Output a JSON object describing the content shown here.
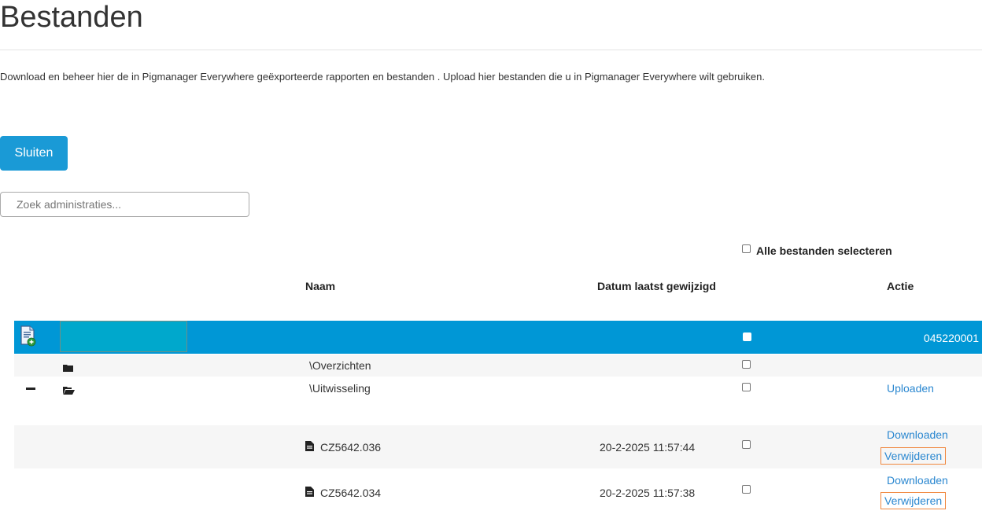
{
  "page": {
    "title": "Bestanden",
    "intro": "Download en beheer hier de in Pigmanager Everywhere geëxporteerde rapporten en bestanden . Upload hier bestanden die u in Pigmanager Everywhere wilt gebruiken."
  },
  "actions": {
    "close_label": "Sluiten"
  },
  "search": {
    "placeholder": "Zoek administraties...",
    "value": ""
  },
  "table": {
    "select_all_label": "Alle bestanden selecteren",
    "headers": {
      "name": "Naam",
      "modified": "Datum laatst gewijzigd",
      "action": "Actie"
    },
    "admin_row": {
      "code": "045220001",
      "icon": "add-document-icon",
      "checked": true
    },
    "folders": [
      {
        "name": "\\Overzichten",
        "icon": "folder-icon"
      },
      {
        "name": "\\Uitwisseling",
        "icon": "folder-open-icon",
        "action": "Uploaden"
      }
    ],
    "files": [
      {
        "name": "CZ5642.036",
        "modified": "20-2-2025 11:57:44",
        "download": "Downloaden",
        "delete": "Verwijderen"
      },
      {
        "name": "CZ5642.034",
        "modified": "20-2-2025 11:57:38",
        "download": "Downloaden",
        "delete": "Verwijderen"
      }
    ]
  },
  "colors": {
    "primary": "#1a9ad6",
    "selected_row": "#0097d6",
    "link": "#2a87d0",
    "highlight_border": "#f0873e",
    "row_alt": "#f6f6f6"
  }
}
